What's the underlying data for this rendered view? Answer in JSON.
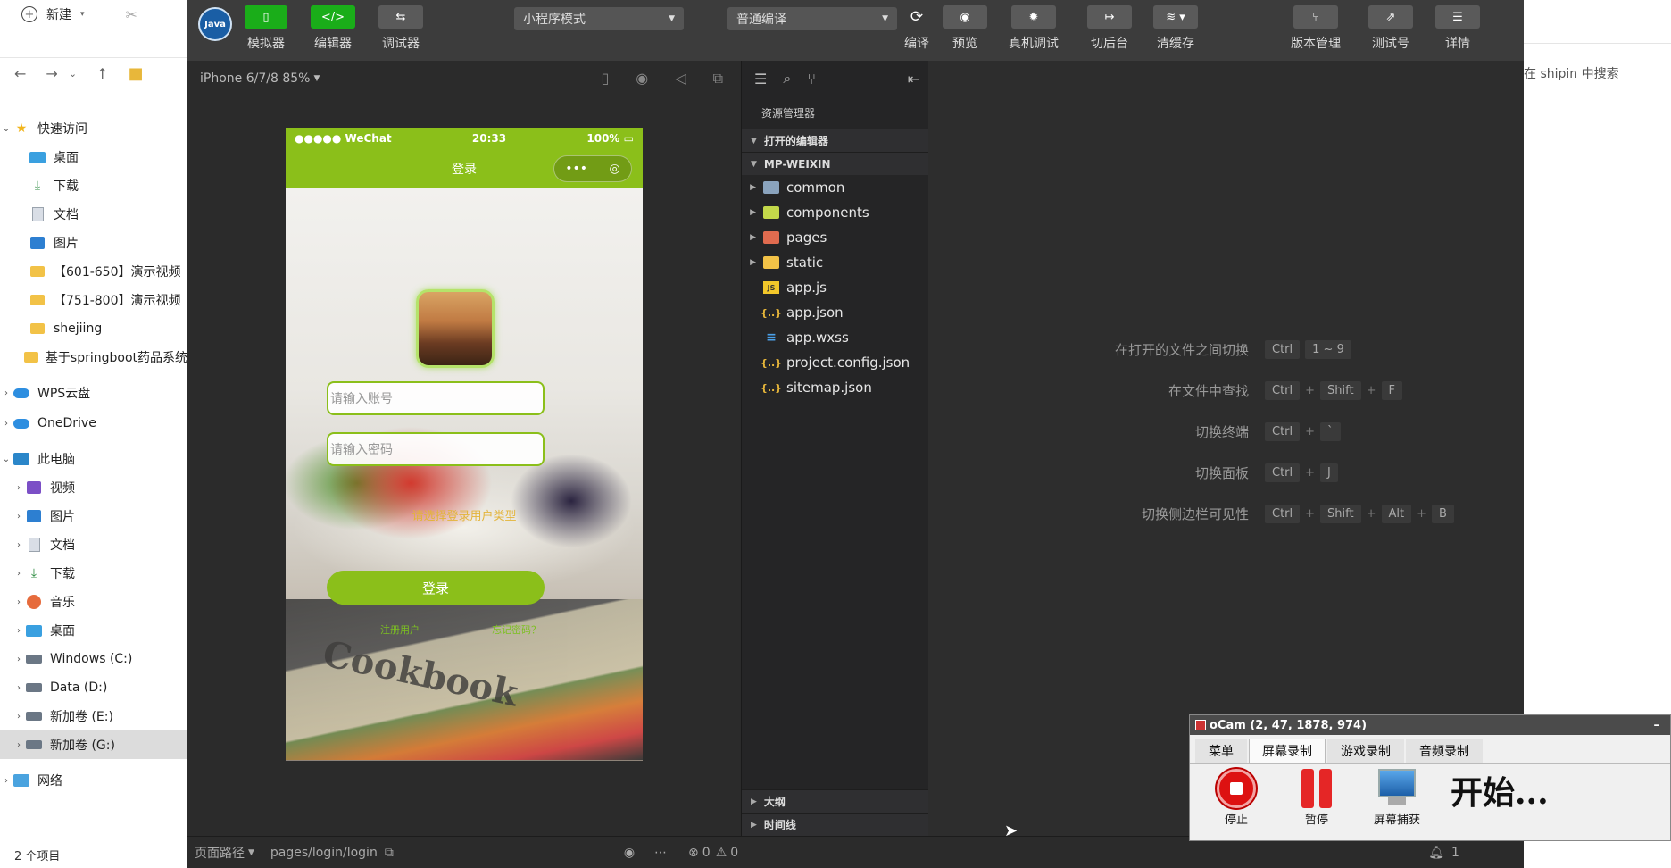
{
  "explorer": {
    "new_label": "新建",
    "quick_access": "快速访问",
    "quick_items": [
      "桌面",
      "下载",
      "文档",
      "图片",
      "【601-650】演示视频",
      "【751-800】演示视频",
      "shejiing",
      "基于springboot药品系统"
    ],
    "wps": "WPS云盘",
    "onedrive": "OneDrive",
    "this_pc": "此电脑",
    "pc_items": [
      "视频",
      "图片",
      "文档",
      "下载",
      "音乐",
      "桌面",
      "Windows (C:)",
      "Data (D:)",
      "新加卷 (E:)",
      "新加卷 (G:)"
    ],
    "network": "网络",
    "footer": "2 个项目",
    "search_placeholder": "在 shipin 中搜索"
  },
  "toolbar": {
    "simulator": "模拟器",
    "editor": "编辑器",
    "debugger": "调试器",
    "mode": "小程序模式",
    "compile_mode": "普通编译",
    "compile": "编译",
    "preview": "预览",
    "device_debug": "真机调试",
    "background": "切后台",
    "clear_cache": "清缓存",
    "version": "版本管理",
    "test_account": "测试号",
    "details": "详情"
  },
  "simulator": {
    "device": "iPhone 6/7/8 85%",
    "status_carrier": "●●●●● WeChat",
    "status_time": "20:33",
    "status_battery": "100%",
    "page_title": "登录",
    "account_placeholder": "请输入账号",
    "password_placeholder": "请输入密码",
    "user_type": "请选择登录用户类型",
    "login_button": "登录",
    "register_link": "注册用户",
    "forgot_link": "忘记密码？"
  },
  "files": {
    "panel_title": "资源管理器",
    "open_editors": "打开的编辑器",
    "project": "MP-WEIXIN",
    "folders": [
      "common",
      "components",
      "pages",
      "static"
    ],
    "items": [
      "app.js",
      "app.json",
      "app.wxss",
      "project.config.json",
      "sitemap.json"
    ],
    "outline": "大纲",
    "timeline": "时间线"
  },
  "shortcuts": [
    {
      "label": "在打开的文件之间切换",
      "keys": [
        "Ctrl",
        "1 ~ 9"
      ]
    },
    {
      "label": "在文件中查找",
      "keys": [
        "Ctrl",
        "Shift",
        "F"
      ]
    },
    {
      "label": "切换终端",
      "keys": [
        "Ctrl",
        "`"
      ]
    },
    {
      "label": "切换面板",
      "keys": [
        "Ctrl",
        "J"
      ]
    },
    {
      "label": "切换侧边栏可见性",
      "keys": [
        "Ctrl",
        "Shift",
        "Alt",
        "B"
      ]
    }
  ],
  "statusbar": {
    "page_path_label": "页面路径",
    "page_path": "pages/login/login",
    "errors": "0",
    "warnings": "0",
    "notifications": "1"
  },
  "ocam": {
    "title": "oCam (2, 47, 1878, 974)",
    "tabs": [
      "菜单",
      "屏幕录制",
      "游戏录制",
      "音频录制"
    ],
    "stop": "停止",
    "pause": "暂停",
    "capture": "屏幕捕获",
    "status": "开始..."
  }
}
